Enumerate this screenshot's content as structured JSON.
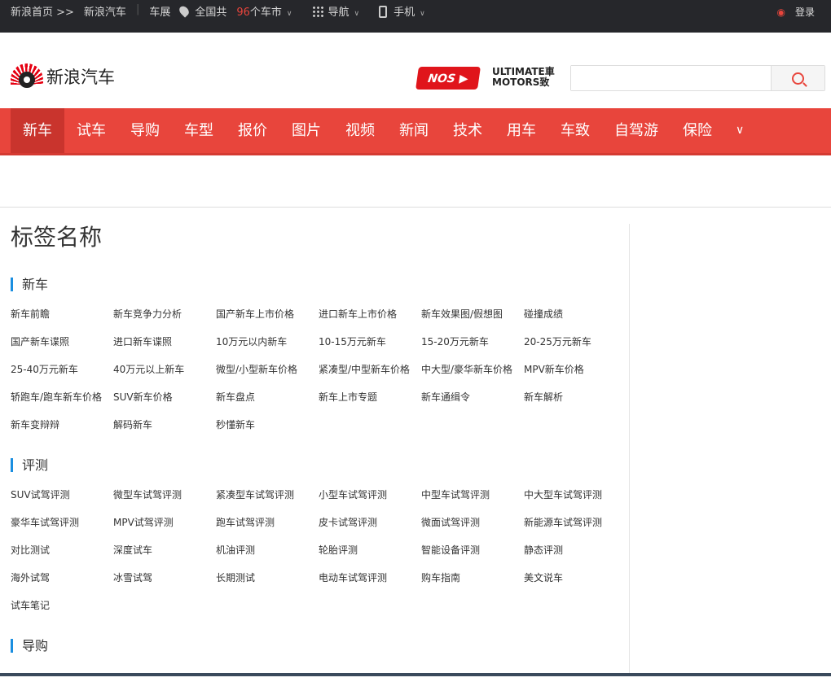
{
  "topbar": {
    "home": "新浪首页 >>",
    "auto": "新浪汽车",
    "show": "车展",
    "city_pre": "全国共",
    "city_num": "96",
    "city_post": "个车市",
    "nav": "导航",
    "mobile": "手机",
    "login": "登录"
  },
  "header": {
    "logo_text": "新浪汽车",
    "nos_logo": "AutoSinaTV NOS",
    "ultimate_line1": "ULTIMATE車",
    "ultimate_line2": "MOTORS致",
    "search_placeholder": ""
  },
  "nav": [
    "新车",
    "试车",
    "导购",
    "车型",
    "报价",
    "图片",
    "视频",
    "新闻",
    "技术",
    "用车",
    "车致",
    "自驾游",
    "保险"
  ],
  "page_title": "标签名称",
  "sections": [
    {
      "title": "新车",
      "links": [
        "新车前瞻",
        "新车竞争力分析",
        "国产新车上市价格",
        "进口新车上市价格",
        "新车效果图/假想图",
        "碰撞成绩",
        "国产新车谍照",
        "进口新车谍照",
        "10万元以内新车",
        "10-15万元新车",
        "15-20万元新车",
        "20-25万元新车",
        "25-40万元新车",
        "40万元以上新车",
        "微型/小型新车价格",
        "紧凑型/中型新车价格",
        "中大型/豪华新车价格",
        "MPV新车价格",
        "轿跑车/跑车新车价格",
        "SUV新车价格",
        "新车盘点",
        "新车上市专题",
        "新车通缉令",
        "新车解析",
        "新车变辩辩",
        "解码新车",
        "秒懂新车"
      ]
    },
    {
      "title": "评测",
      "links": [
        "SUV试驾评测",
        "微型车试驾评测",
        "紧凑型车试驾评测",
        "小型车试驾评测",
        "中型车试驾评测",
        "中大型车试驾评测",
        "豪华车试驾评测",
        "MPV试驾评测",
        "跑车试驾评测",
        "皮卡试驾评测",
        "微面试驾评测",
        "新能源车试驾评测",
        "对比测试",
        "深度试车",
        "机油评测",
        "轮胎评测",
        "智能设备评测",
        "静态评测",
        "海外试驾",
        "冰雪试驾",
        "长期测试",
        "电动车试驾评测",
        "购车指南",
        "美文说车",
        "试车笔记"
      ]
    },
    {
      "title": "导购",
      "links": []
    }
  ],
  "colors": {
    "brand_red": "#e8453c",
    "accent_blue": "#1a8ee0",
    "topbar_bg": "#26272b"
  }
}
